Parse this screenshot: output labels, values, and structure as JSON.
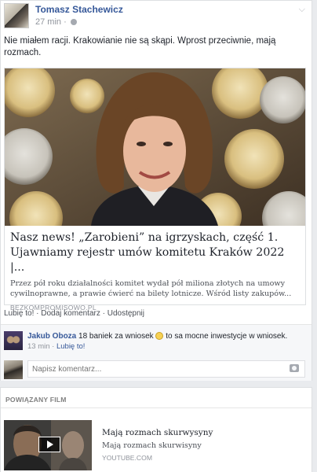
{
  "post": {
    "author": "Tomasz Stachewicz",
    "time": "27 min ·",
    "text": "Nie miałem racji. Krakowianie nie są skąpi. Wprost przeciwnie, mają rozmach."
  },
  "link": {
    "title": "Nasz news! „Zarobieni” na igrzyskach, część 1. Ujawniamy rejestr umów komitetu Kraków 2022 |...",
    "description": "Przez pół roku działalności komitet wydał pół miliona złotych na umowy cywilnoprawne, a prawie ćwierć na bilety lotnicze. Wśród listy zakupów...",
    "source": "BEZKOMPROMISOWO.PL"
  },
  "actions": {
    "like": "Lubię to!",
    "sep1": " · ",
    "comment": "Dodaj komentarz",
    "sep2": " · ",
    "share": "Udostępnij"
  },
  "comment": {
    "author": "Jakub Oboza",
    "text_before": " 18 baniek za wniosek ",
    "text_after": " to sa mocne inwestycje w wniosek.",
    "time": "13 min · ",
    "like": "Lubię to!"
  },
  "comment_input": {
    "placeholder": "Napisz komentarz..."
  },
  "related": {
    "header": "POWIĄZANY FILM",
    "video_title": "Mają rozmach skurwysyny",
    "video_desc": "Mają rozmach skurwisyny",
    "video_source": "YOUTUBE.COM"
  },
  "colors": {
    "link": "#365899",
    "muted": "#90949c",
    "text": "#1d2129"
  },
  "icons": [
    "globe-icon",
    "chevron-down-icon",
    "smiley-icon",
    "camera-icon",
    "play-icon"
  ]
}
